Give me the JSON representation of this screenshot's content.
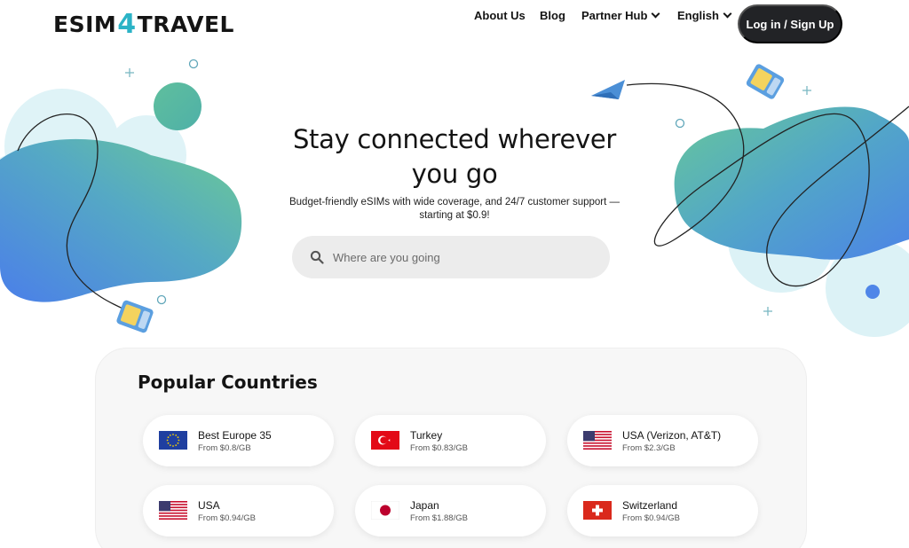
{
  "header": {
    "logo_left": "ESIM",
    "logo_mid": "4",
    "logo_right": "TRAVEL",
    "nav": {
      "about": "About Us",
      "blog": "Blog",
      "partner": "Partner Hub",
      "language": "English"
    },
    "login_label": "Log in / Sign Up"
  },
  "hero": {
    "title_line1": "Stay connected wherever",
    "title_line2": "you go",
    "subtitle_line1": "Budget-friendly eSIMs with wide coverage, and 24/7 customer support —",
    "subtitle_line2": "starting at $0.9!",
    "search_placeholder": "Where are you going"
  },
  "popular": {
    "title": "Popular Countries",
    "countries": [
      {
        "name": "Best Europe 35",
        "price": "From $0.8/GB",
        "flag": "eu-flag-icon"
      },
      {
        "name": "Turkey",
        "price": "From $0.83/GB",
        "flag": "turkey-flag-icon"
      },
      {
        "name": "USA (Verizon, AT&T)",
        "price": "From $2.3/GB",
        "flag": "usa-flag-icon"
      },
      {
        "name": "USA",
        "price": "From $0.94/GB",
        "flag": "usa-flag-icon"
      },
      {
        "name": "Japan",
        "price": "From $1.88/GB",
        "flag": "japan-flag-icon"
      },
      {
        "name": "Switzerland",
        "price": "From $0.94/GB",
        "flag": "switzerland-flag-icon"
      }
    ]
  },
  "colors": {
    "brand_accent": "#2bb3c6",
    "button_dark": "#222326",
    "blob_blue": "#4f86e8",
    "blob_green": "#63c49a",
    "blob_light": "#d6f1f6"
  }
}
